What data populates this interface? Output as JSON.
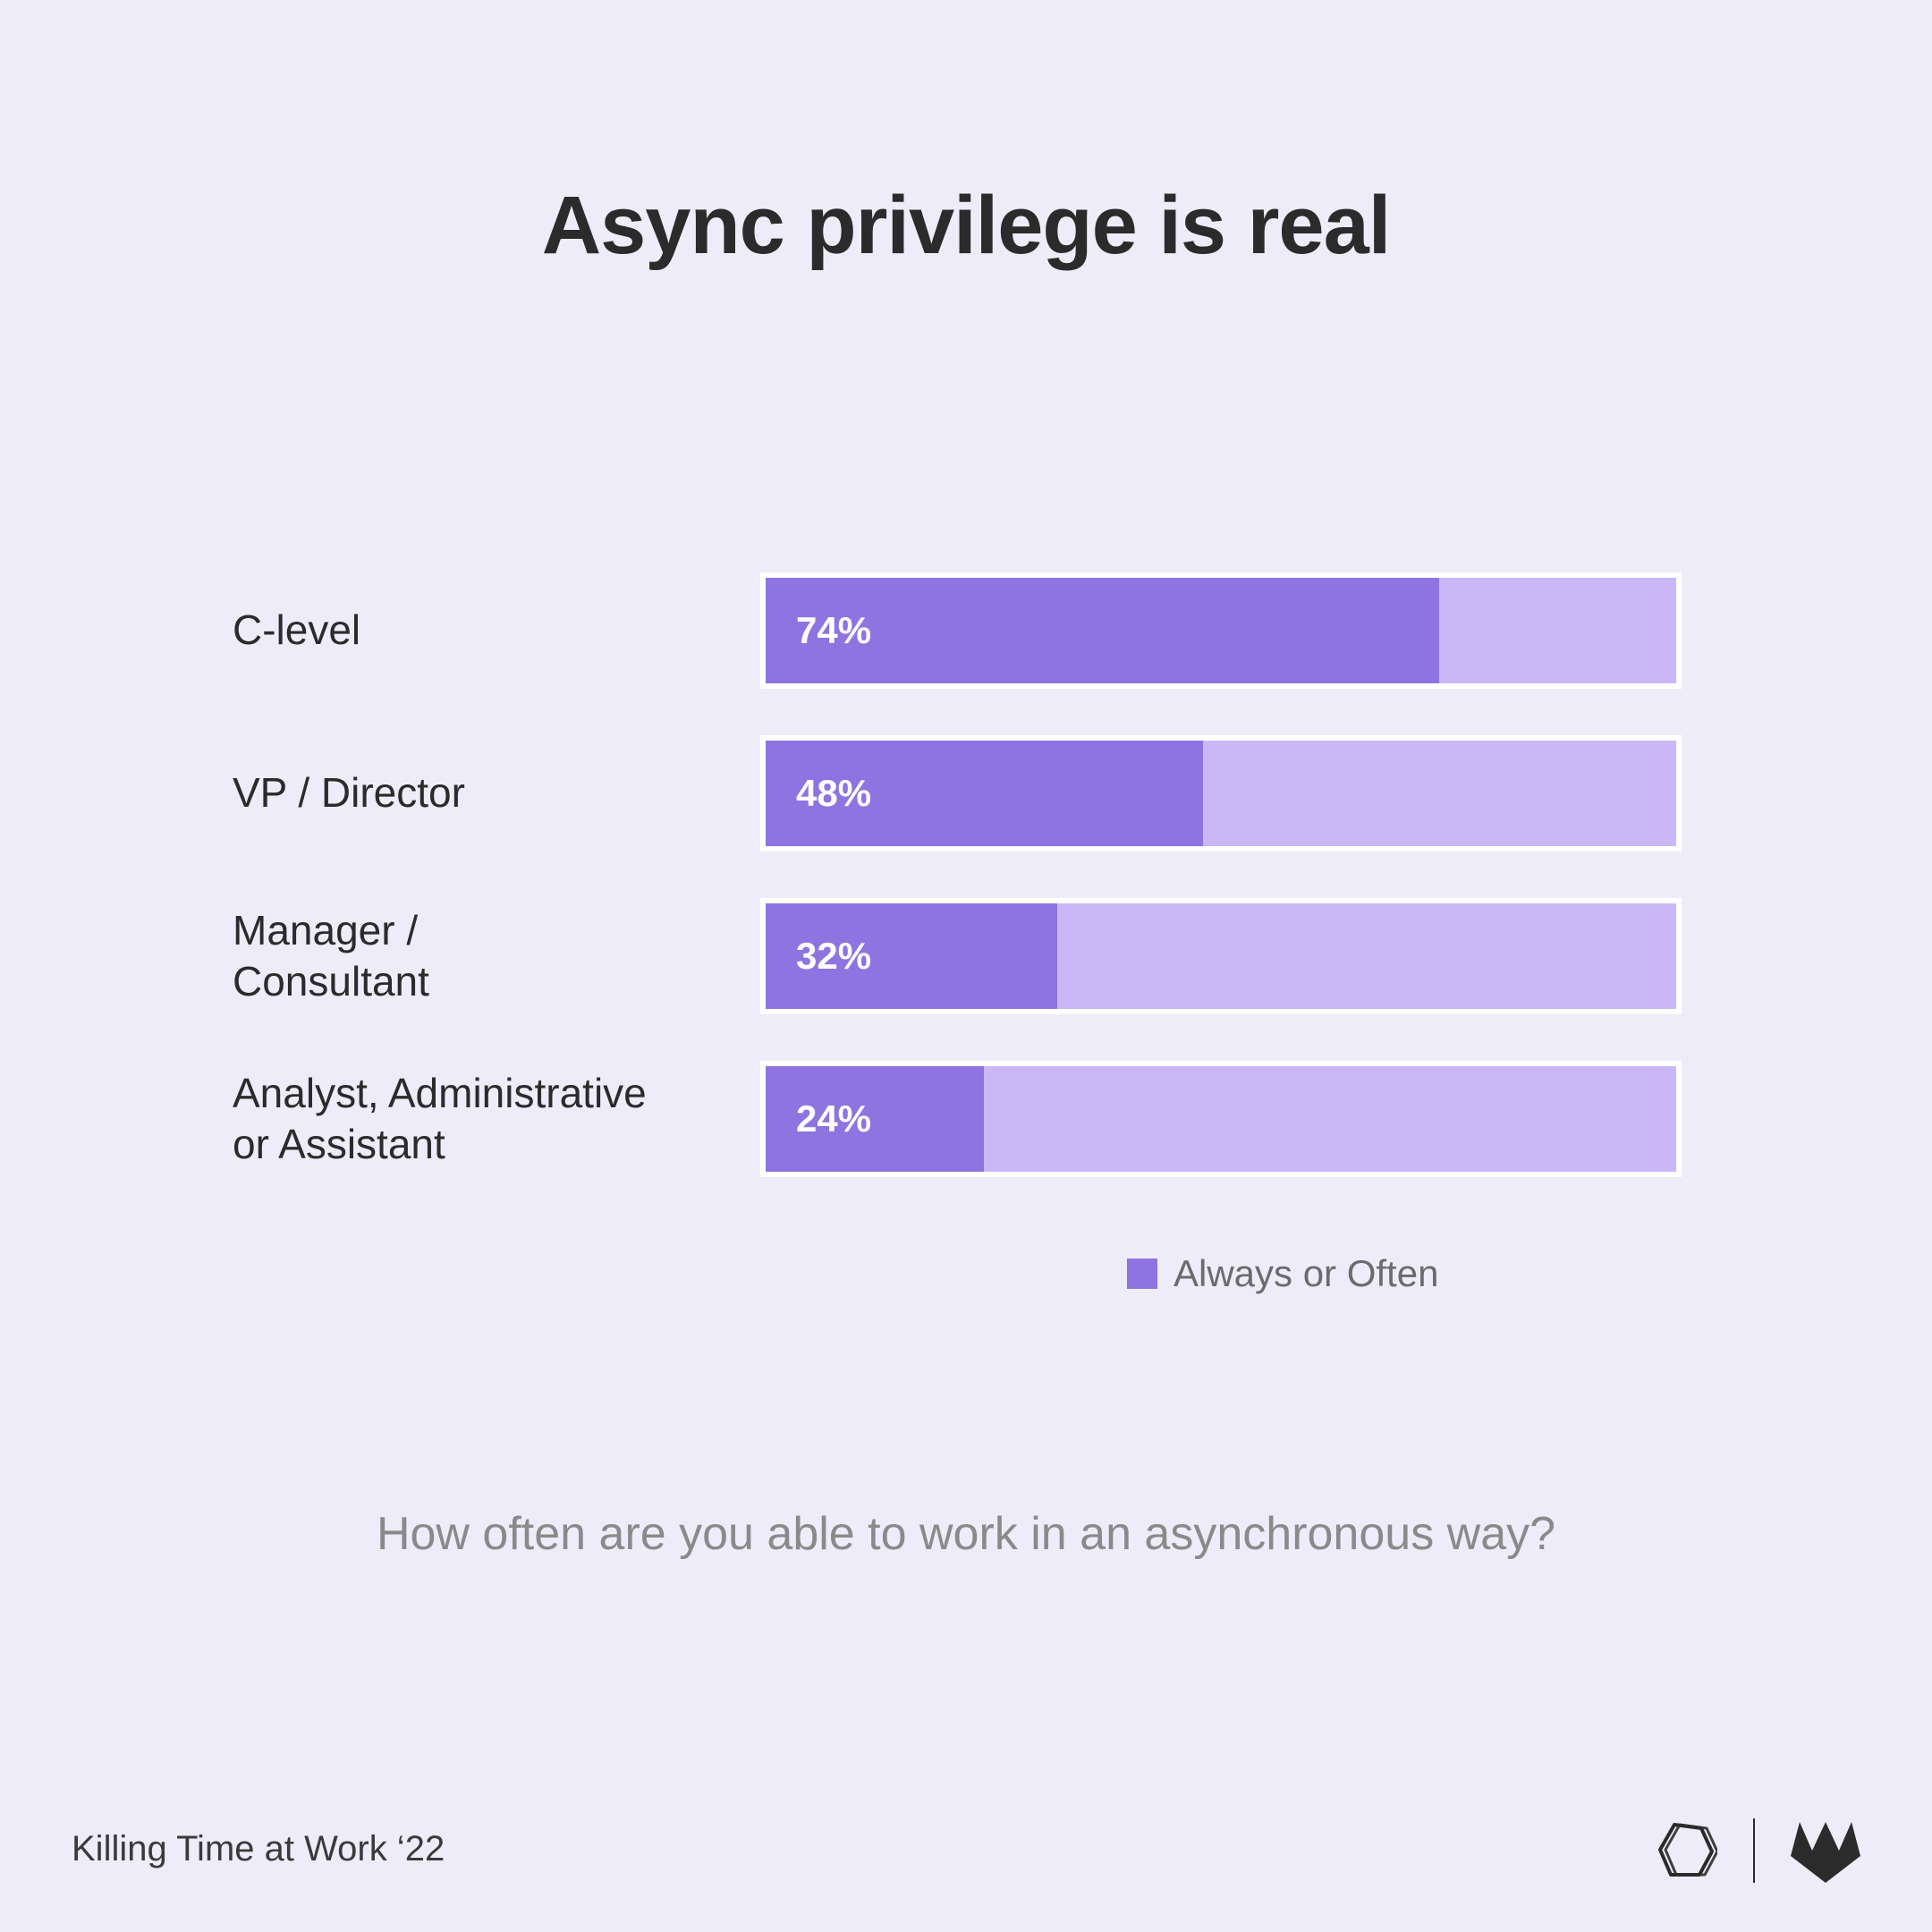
{
  "chart_data": {
    "type": "bar",
    "title": "Async privilege is real",
    "subtitle": "How often are you able to work in an asynchronous way?",
    "categories": [
      "C-level",
      "VP / Director",
      "Manager / Consultant",
      "Analyst, Administrative or Assistant"
    ],
    "values": [
      74,
      48,
      32,
      24
    ],
    "value_labels": [
      "74%",
      "48%",
      "32%",
      "24%"
    ],
    "series_name": "Always or Often",
    "xlabel": "",
    "ylabel": "",
    "xlim": [
      0,
      100
    ],
    "orientation": "horizontal",
    "colors": {
      "foreground": "#8E74E0",
      "background": "#C9B8F5",
      "frame": "#FFFFFF"
    }
  },
  "legend": {
    "label": "Always or Often"
  },
  "footer": {
    "source": "Killing Time at Work ‘22"
  }
}
